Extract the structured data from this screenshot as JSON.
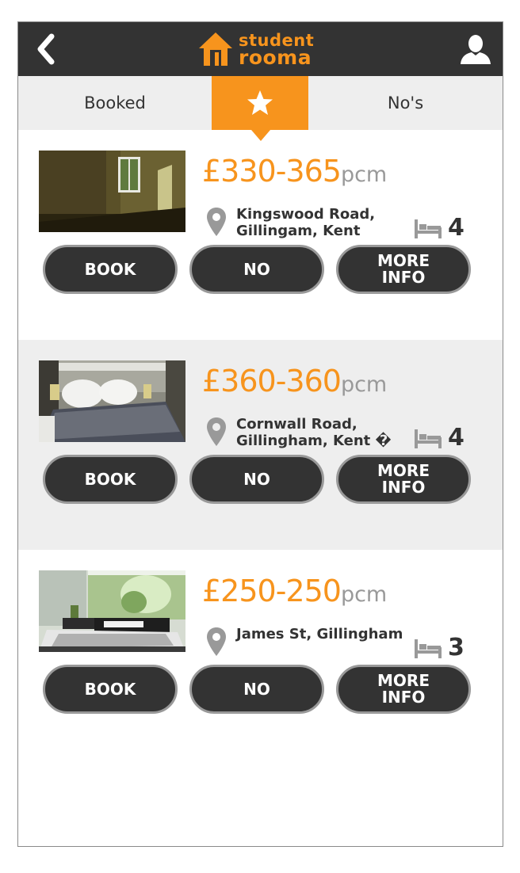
{
  "header": {
    "logo_line1": "student",
    "logo_line2": "rooma",
    "back_icon": "chevron-left-icon",
    "user_icon": "user-icon"
  },
  "tabs": [
    {
      "label": "Booked"
    },
    {
      "label": "",
      "icon": "star-icon",
      "active": true
    },
    {
      "label": "No's"
    }
  ],
  "listings": [
    {
      "price_range": "£330-365",
      "price_unit": "pcm",
      "address": "Kingswood Road, Gillingam, Kent",
      "beds": "4",
      "book_label": "BOOK",
      "no_label": "NO",
      "more_label": "MORE\nINFO"
    },
    {
      "price_range": "£360-360",
      "price_unit": "pcm",
      "address": "Cornwall Road, Gillingham, Kent �",
      "beds": "4",
      "book_label": "BOOK",
      "no_label": "NO",
      "more_label": "MORE\nINFO"
    },
    {
      "price_range": "£250-250",
      "price_unit": "pcm",
      "address": "James St, Gillingham",
      "beds": "3",
      "book_label": "BOOK",
      "no_label": "NO",
      "more_label": "MORE\nINFO"
    }
  ],
  "colors": {
    "accent": "#F7941D",
    "header_bg": "#333333",
    "tab_bg": "#EEEEEE",
    "button_bg": "#333333",
    "button_border": "#999999"
  }
}
